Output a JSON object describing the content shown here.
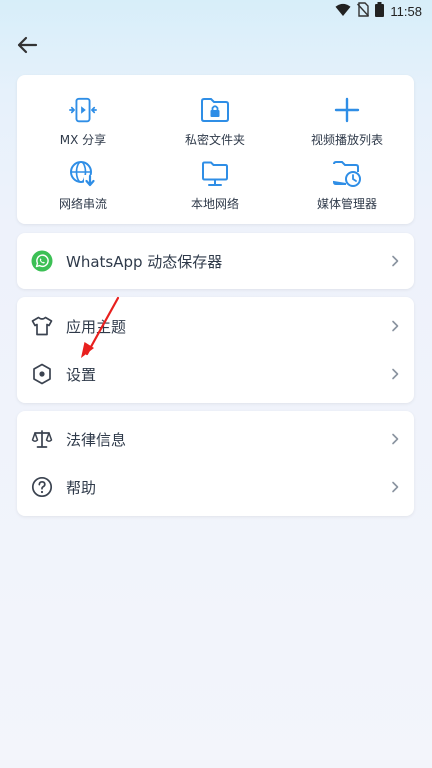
{
  "status_bar": {
    "time": "11:58"
  },
  "toolbar": {
    "back_icon": "arrow-left-icon"
  },
  "quick_actions": [
    {
      "label": "MX 分享",
      "icon": "mx-share-icon"
    },
    {
      "label": "私密文件夹",
      "icon": "private-folder-icon"
    },
    {
      "label": "视频播放列表",
      "icon": "plus-icon"
    },
    {
      "label": "网络串流",
      "icon": "network-stream-icon"
    },
    {
      "label": "本地网络",
      "icon": "local-network-icon"
    },
    {
      "label": "媒体管理器",
      "icon": "media-manager-icon"
    }
  ],
  "whatsapp_card": {
    "label": "WhatsApp 动态保存器",
    "icon": "whatsapp-icon"
  },
  "settings_card": {
    "items": [
      {
        "label": "应用主题",
        "icon": "tshirt-icon"
      },
      {
        "label": "设置",
        "icon": "hexagon-settings-icon"
      }
    ]
  },
  "info_card": {
    "items": [
      {
        "label": "法律信息",
        "icon": "scale-icon"
      },
      {
        "label": "帮助",
        "icon": "help-circle-icon"
      }
    ]
  },
  "colors": {
    "accent": "#2f8ee6",
    "whatsapp": "#3cc055",
    "annotation": "#e8201e",
    "text": "#2f3a4a"
  }
}
